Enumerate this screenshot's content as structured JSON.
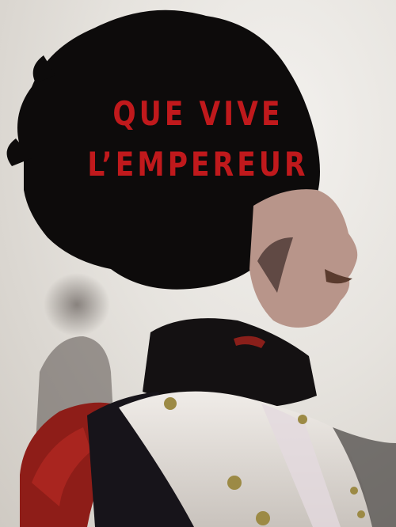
{
  "poster": {
    "title_line_1": "QUE VIVE",
    "title_line_2": "L’EMPEREUR",
    "title_color": "#c0191c"
  }
}
